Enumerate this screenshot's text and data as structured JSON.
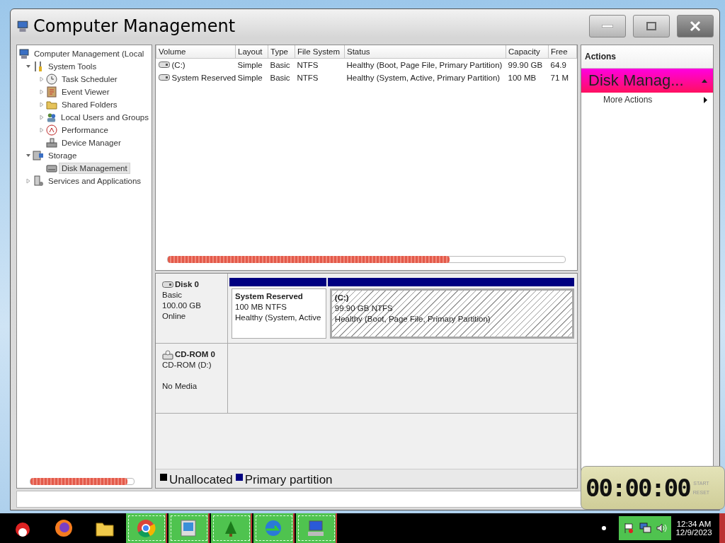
{
  "window": {
    "title": "Computer Management"
  },
  "tree": [
    {
      "label": "Computer Management (Local",
      "selected": false,
      "children": [
        {
          "label": "System Tools",
          "expanded": true,
          "selected": false,
          "children": [
            {
              "label": "Task Scheduler",
              "expanded": false,
              "selected": false
            },
            {
              "label": "Event Viewer",
              "expanded": false,
              "selected": false
            },
            {
              "label": "Shared Folders",
              "expanded": false,
              "selected": false
            },
            {
              "label": "Local Users and Groups",
              "expanded": false,
              "selected": false
            },
            {
              "label": "Performance",
              "expanded": false,
              "selected": false
            },
            {
              "label": "Device Manager",
              "selected": false
            }
          ]
        },
        {
          "label": "Storage",
          "expanded": true,
          "selected": false,
          "children": [
            {
              "label": "Disk Management",
              "selected": true
            }
          ]
        },
        {
          "label": "Services and Applications",
          "expanded": false,
          "selected": false
        }
      ]
    }
  ],
  "table": {
    "columns": [
      "Volume",
      "Layout",
      "Type",
      "File System",
      "Status",
      "Capacity",
      "Free"
    ],
    "rows": [
      [
        "(C:)",
        "Simple",
        "Basic",
        "NTFS",
        "Healthy (Boot, Page File, Primary Partition)",
        "99.90 GB",
        "64.9"
      ],
      [
        "System Reserved",
        "Simple",
        "Basic",
        "NTFS",
        "Healthy (System, Active, Primary Partition)",
        "100 MB",
        "71 M"
      ]
    ]
  },
  "disks": [
    {
      "kind": "disk",
      "name": "Disk 0",
      "type": "Basic",
      "size": "100.00 GB",
      "status": "Online",
      "partitions": [
        {
          "name": "System Reserved",
          "size": "100 MB NTFS",
          "status": "Healthy (System, Active",
          "selected": false
        },
        {
          "name": "(C:)",
          "size": "99.90 GB NTFS",
          "status": "Healthy (Boot, Page File, Primary Partition)",
          "selected": true
        }
      ]
    },
    {
      "kind": "cdrom",
      "name": "CD-ROM 0",
      "type": "CD-ROM (D:)",
      "status": "No Media"
    }
  ],
  "legend": [
    {
      "label": "Unallocated",
      "color": "#000000"
    },
    {
      "label": "Primary partition",
      "color": "#000080"
    }
  ],
  "actions": {
    "title": "Actions",
    "section": "Disk Manag...",
    "items": [
      "More Actions"
    ]
  },
  "timer": {
    "display": "00:00:00",
    "buttons": [
      "START",
      "RESET"
    ]
  },
  "taskbar": {
    "apps": [
      {
        "running": false
      },
      {
        "running": false
      },
      {
        "running": false
      },
      {
        "running": true
      },
      {
        "running": true
      },
      {
        "running": true
      },
      {
        "running": true
      },
      {
        "running": true
      }
    ],
    "time": "12:34 AM",
    "date": "12/9/2023"
  }
}
